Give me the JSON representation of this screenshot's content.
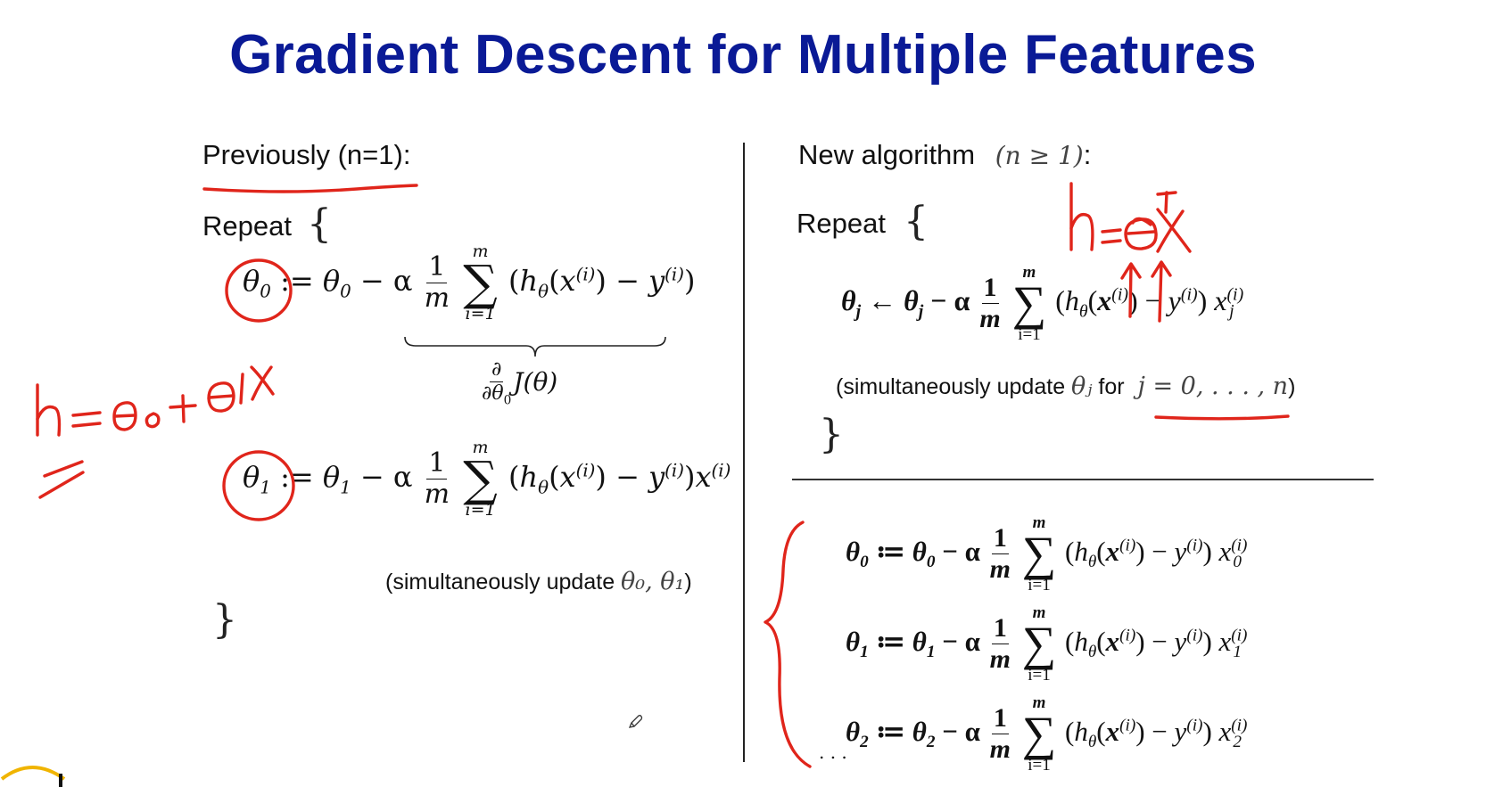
{
  "title": "Gradient Descent for Multiple Features",
  "left": {
    "heading": "Previously (n=1):",
    "repeat": "Repeat",
    "open_brace": "{",
    "close_brace": "}",
    "eq0": {
      "lhs": "θ",
      "lhs_sub": "0",
      "assign": ":= ",
      "rhs_var": "θ",
      "rhs_sub": "0",
      "minus_alpha": "− α",
      "frac_num": "1",
      "frac_den": "m",
      "sum_top": "m",
      "sum_sym": "∑",
      "sum_bot": "i=1",
      "body": "(h",
      "body_sub": "θ",
      "body2": "(x",
      "body_sup": "(i)",
      "body3": ") − y",
      "body_sup2": "(i)",
      "body4": ")"
    },
    "derivative": {
      "num": "∂",
      "den": "∂θ",
      "den_sub": "0",
      "fn": "J(θ)"
    },
    "eq1": {
      "lhs": "θ",
      "lhs_sub": "1",
      "assign": ":= ",
      "rhs_var": "θ",
      "rhs_sub": "1",
      "minus_alpha": "− α",
      "frac_num": "1",
      "frac_den": "m",
      "sum_top": "m",
      "sum_sym": "∑",
      "sum_bot": "i=1",
      "body": "(h",
      "body_sub": "θ",
      "body2": "(x",
      "body_sup": "(i)",
      "body3": ") − y",
      "body_sup2": "(i)",
      "body4": ")x",
      "body_sup3": "(i)"
    },
    "note_text": "(simultaneously update ",
    "note_math": "θ₀, θ₁",
    "note_close": ")"
  },
  "right": {
    "heading": "New algorithm",
    "heading_math": "(n ≥ 1)",
    "heading_colon": ":",
    "repeat": "Repeat",
    "open_brace": "{",
    "close_brace": "}",
    "general": {
      "lhs": "θ",
      "lhs_sub": "j",
      "arrow": " ← ",
      "rhs_var": "θ",
      "rhs_sub": "j",
      "minus_alpha": " − α",
      "frac_num": "1",
      "frac_den": "m",
      "sum_top": "m",
      "sum_sym": "∑",
      "sum_bot": "i=1",
      "body": "(h",
      "body_sub": "θ",
      "body2": "(x",
      "body_sup": "(i)",
      "body3": ") − y",
      "body_sup2": "(i)",
      "body4": ") x",
      "body_sub3": "j",
      "body_sup3": "(i)"
    },
    "note_text": "(simultaneously update ",
    "note_math": "θⱼ",
    "note_for": " for ",
    "note_range": "j = 0, . . . , n",
    "note_close": ")",
    "expanded": [
      {
        "sub": "0",
        "xsub": "0"
      },
      {
        "sub": "1",
        "xsub": "1"
      },
      {
        "sub": "2",
        "xsub": "2"
      }
    ],
    "expanded_assign": " ≔ ",
    "ellipsis": ". . ."
  },
  "ink_notes": {
    "left_hypothesis": "h = θ₀ + θ₁x",
    "right_hypothesis": "h = θᵀx"
  },
  "colors": {
    "title": "#0a1a96",
    "ink": "#e0251b",
    "logo": "#f0b400"
  },
  "icons": [
    "pencil-cursor-icon",
    "university-logo"
  ]
}
